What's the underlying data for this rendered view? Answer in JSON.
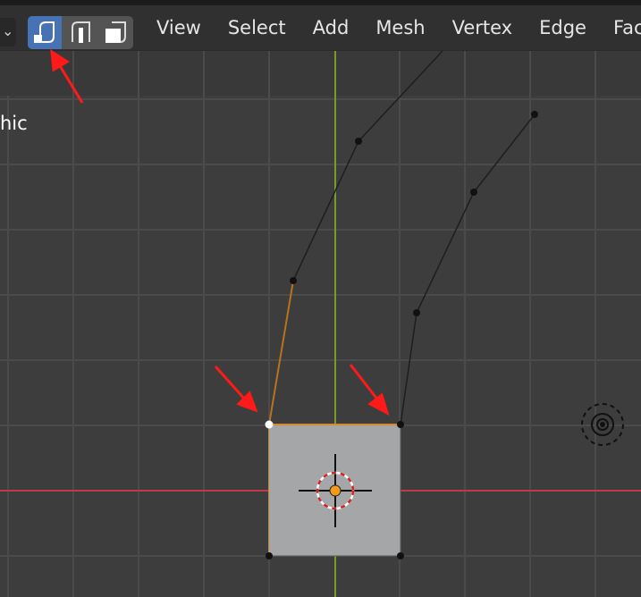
{
  "header": {
    "dropdown_glyph": "⌄",
    "select_modes": [
      {
        "name": "vertex-select-mode",
        "icon": "vertex-select-icon",
        "active": true
      },
      {
        "name": "edge-select-mode",
        "icon": "edge-select-icon",
        "active": false
      },
      {
        "name": "face-select-mode",
        "icon": "face-select-icon",
        "active": false
      }
    ],
    "menu": [
      "View",
      "Select",
      "Add",
      "Mesh",
      "Vertex",
      "Edge",
      "Face"
    ]
  },
  "viewport": {
    "overlay_text": "hic"
  },
  "colors": {
    "header_bg": "#303030",
    "viewport_bg": "#3d3d3d",
    "grid_line": "#4a4a4a",
    "x_axis": "#c0394b",
    "y_axis": "#7a9a2a",
    "active_mode": "#4772b3",
    "selected_edge": "#e08a1e",
    "face_fill": "#a5a6a8",
    "annotation_arrow": "#ff1a1a"
  }
}
